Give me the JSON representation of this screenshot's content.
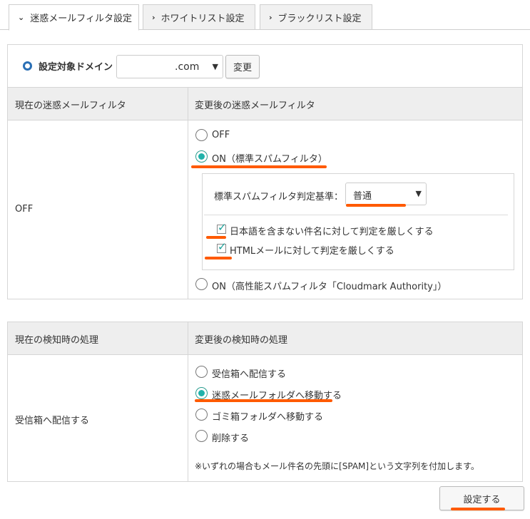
{
  "tabs": [
    {
      "label": "迷惑メールフィルタ設定",
      "active": true
    },
    {
      "label": "ホワイトリスト設定",
      "active": false
    },
    {
      "label": "ブラックリスト設定",
      "active": false
    }
  ],
  "domain": {
    "label": "設定対象ドメイン",
    "selected": ".com",
    "change_button": "変更"
  },
  "filter": {
    "col_current": "現在の迷惑メールフィルタ",
    "col_new": "変更後の迷惑メールフィルタ",
    "current_value": "OFF",
    "options": [
      {
        "label": "OFF",
        "checked": false
      },
      {
        "label": "ON（標準スパムフィルタ）",
        "checked": true
      },
      {
        "label": "ON（高性能スパムフィルタ「Cloudmark Authority」）",
        "checked": false
      }
    ],
    "standard": {
      "criteria_label": "標準スパムフィルタ判定基準：",
      "criteria_value": "普通",
      "checks": [
        {
          "label": "日本語を含まない件名に対して判定を厳しくする",
          "checked": true
        },
        {
          "label": "HTMLメールに対して判定を厳しくする",
          "checked": true
        }
      ]
    }
  },
  "action": {
    "col_current": "現在の検知時の処理",
    "col_new": "変更後の検知時の処理",
    "current_value": "受信箱へ配信する",
    "options": [
      {
        "label": "受信箱へ配信する",
        "checked": false
      },
      {
        "label": "迷惑メールフォルダへ移動する",
        "checked": true
      },
      {
        "label": "ゴミ箱フォルダへ移動する",
        "checked": false
      },
      {
        "label": "削除する",
        "checked": false
      }
    ],
    "note": "※いずれの場合もメール件名の先頭に[SPAM]という文字列を付加します。"
  },
  "save_button": "設定する",
  "colors": {
    "accent": "#20b2aa",
    "highlight": "#ff5a00",
    "bullet": "#2a6fb5"
  }
}
